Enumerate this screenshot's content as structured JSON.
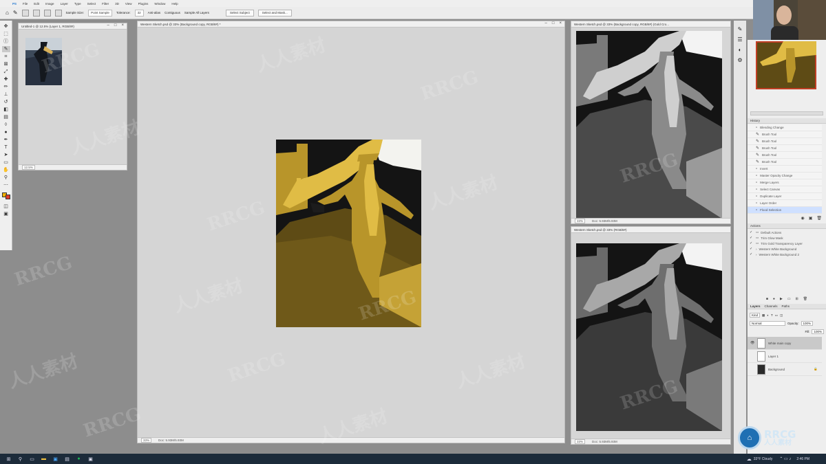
{
  "menu": [
    "PS",
    "File",
    "Edit",
    "Image",
    "Layer",
    "Type",
    "Select",
    "Filter",
    "3D",
    "View",
    "Plugins",
    "Window",
    "Help"
  ],
  "options": {
    "sample_label": "Sample Size:",
    "sample_value": "Point Sample",
    "tolerance_label": "Tolerance:",
    "tolerance_value": "32",
    "antialias": "Anti-alias",
    "contiguous": "Contiguous",
    "sample_all_layers": "Sample All Layers",
    "select_subject": "Select Subject",
    "select_and_mask": "Select and Mask..."
  },
  "tools": [
    "move",
    "marquee",
    "lasso",
    "quick-select",
    "crop",
    "frame",
    "eyedropper",
    "healing",
    "brush",
    "stamp",
    "history-brush",
    "eraser",
    "gradient",
    "blur",
    "dodge",
    "pen",
    "type",
    "path-select",
    "shape",
    "hand",
    "zoom",
    "more"
  ],
  "colors": {
    "foreground": "#f0b000",
    "background": "#e23a2a",
    "gold": "#b8952a",
    "dark_gold": "#5e4b15"
  },
  "navigator_doc": {
    "title": "Untitled-1 @ 12.5% (Layer 1, RGB/8#)",
    "zoom": "12.5%"
  },
  "main_doc": {
    "title": "Western Sketch.psd @ 33% (Background copy, RGB/8#) *",
    "zoom": "33%",
    "status": "Doc: 5.93M/5.93M"
  },
  "right_top_doc": {
    "title": "Western Sketch.psd @ 33% (Background copy, RGB/8#) (Gold Cro...",
    "zoom": "33%",
    "status": "Doc: 5.93M/5.93M"
  },
  "right_bottom_doc": {
    "title": "Western Sketch.psd @ 33% (RGB/8#)",
    "zoom": "33%",
    "status": "Doc: 5.93M/5.93M"
  },
  "history": {
    "tab": "History",
    "items": [
      "Blending Change",
      "Brush Tool",
      "Brush Tool",
      "Brush Tool",
      "Brush Tool",
      "Brush Tool",
      "Invert",
      "Master Opacity Change",
      "Merge Layers",
      "Select Canvas",
      "Duplicate Layer",
      "Layer Order",
      "Flood Selection"
    ]
  },
  "actions": {
    "tab": "Actions",
    "items": [
      "Default Actions",
      "Trim Glow Mask",
      "Trim Gold Transparency Layer",
      "Western White Background",
      "Western White Background 2"
    ]
  },
  "layers": {
    "tabs": [
      "Layers",
      "Channels",
      "Paths"
    ],
    "kind": "Kind",
    "blend_mode": "Normal",
    "opacity_label": "Opacity:",
    "opacity": "100%",
    "fill_label": "Fill:",
    "fill": "100%",
    "items": [
      {
        "name": "White main copy",
        "selected": true
      },
      {
        "name": "Layer 1",
        "selected": false
      },
      {
        "name": "Background",
        "selected": false
      }
    ]
  },
  "taskbar": {
    "weather": "33°F Cloudy",
    "time": "2:46 PM"
  },
  "watermark": {
    "rrcg": "RRCG",
    "cn": "人人素材",
    "logo_big": "RRCG",
    "logo_small": "人人素材"
  }
}
